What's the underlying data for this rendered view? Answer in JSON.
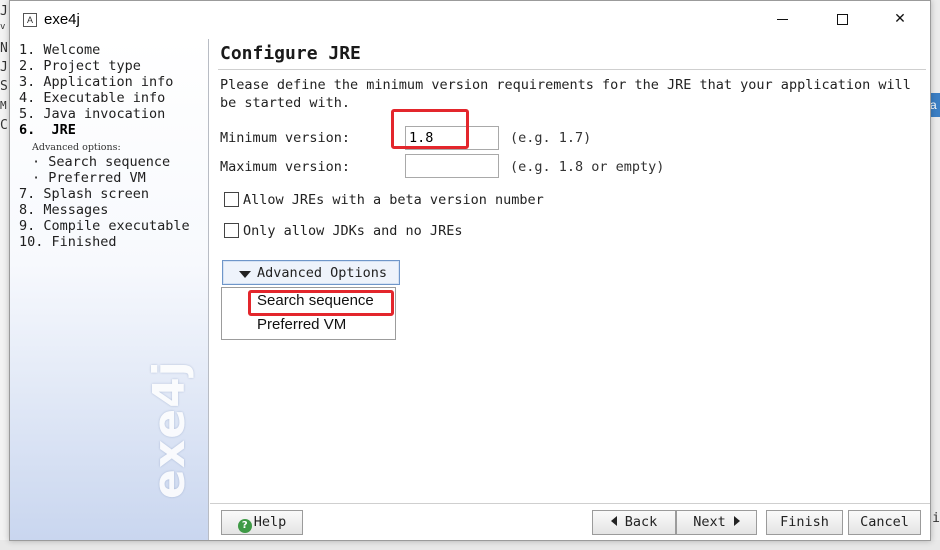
{
  "window": {
    "title": "exe4j",
    "app_icon_glyph": "A",
    "controls": {
      "minimize": "minimize",
      "maximize": "maximize",
      "close": "✕"
    }
  },
  "nav": {
    "steps_top": [
      {
        "label": "1. Welcome"
      },
      {
        "label": "2. Project type"
      },
      {
        "label": "3. Application info"
      },
      {
        "label": "4. Executable info"
      },
      {
        "label": "5. Java invocation"
      },
      {
        "label": "6.  JRE"
      }
    ],
    "advanced_heading": "Advanced options:",
    "advanced_items": [
      {
        "label": "· Search sequence"
      },
      {
        "label": "· Preferred VM"
      }
    ],
    "steps_bottom": [
      {
        "label": "7. Splash screen"
      },
      {
        "label": "8. Messages"
      },
      {
        "label": "9. Compile executable"
      },
      {
        "label": "10. Finished"
      }
    ],
    "watermark": "exe4j"
  },
  "main": {
    "title": "Configure JRE",
    "description": "Please define the minimum version requirements for the JRE that your application will be started with.",
    "min_version": {
      "label": "Minimum version:",
      "value": "1.8",
      "hint": "(e.g. 1.7)"
    },
    "max_version": {
      "label": "Maximum version:",
      "value": "",
      "hint": "(e.g. 1.8 or empty)"
    },
    "checkbox_beta": {
      "label": "Allow JREs with a beta version number",
      "checked": false
    },
    "checkbox_jdk": {
      "label": "Only allow JDKs and no JREs",
      "checked": false
    },
    "advanced_button": "Advanced Options",
    "advanced_menu": [
      "Search sequence",
      "Preferred VM"
    ]
  },
  "buttons": {
    "help": "Help",
    "back": "Back",
    "next": "Next",
    "finish": "Finish",
    "cancel": "Cancel"
  },
  "background": {
    "left_chars": [
      "J",
      "v",
      "N",
      "J",
      "S",
      "M",
      "C"
    ],
    "right_tab": "a",
    "right_char": "i"
  },
  "colors": {
    "highlight_red": "#e3262c",
    "advanced_button_border": "#6f96c9",
    "help_icon": "#3f9a46"
  }
}
